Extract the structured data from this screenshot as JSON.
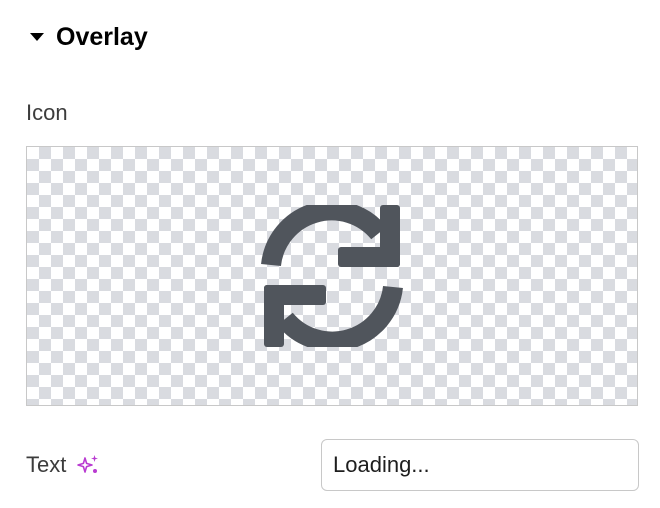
{
  "section": {
    "title": "Overlay",
    "expanded": true
  },
  "icon_field": {
    "label": "Icon",
    "icon": "sync-icon",
    "icon_color": "#50555c"
  },
  "text_field": {
    "label": "Text",
    "ai_icon": "sparkle-icon",
    "ai_icon_color": "#b93bd1",
    "value": "Loading..."
  }
}
